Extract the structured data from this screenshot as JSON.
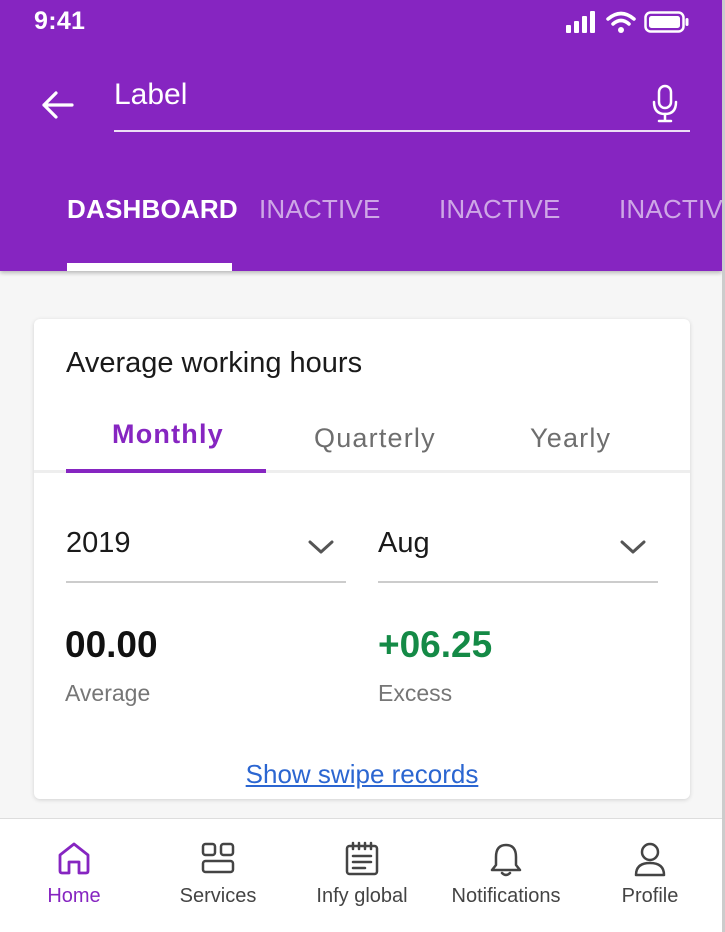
{
  "status_bar": {
    "time": "9:41"
  },
  "search": {
    "value": "Label"
  },
  "top_tabs": [
    {
      "label": "DASHBOARD",
      "active": true
    },
    {
      "label": "INACTIVE",
      "active": false
    },
    {
      "label": "INACTIVE",
      "active": false
    },
    {
      "label": "INACTIVE",
      "active": false
    }
  ],
  "card": {
    "title": "Average working hours",
    "period_tabs": [
      {
        "label": "Monthly",
        "active": true
      },
      {
        "label": "Quarterly",
        "active": false
      },
      {
        "label": "Yearly",
        "active": false
      }
    ],
    "year_select": {
      "value": "2019"
    },
    "month_select": {
      "value": "Aug"
    },
    "average": {
      "value": "00.00",
      "label": "Average"
    },
    "excess": {
      "value": "+06.25",
      "label": "Excess"
    },
    "link": "Show swipe records"
  },
  "bottom_nav": [
    {
      "label": "Home",
      "icon": "home-icon",
      "active": true
    },
    {
      "label": "Services",
      "icon": "grid-icon",
      "active": false
    },
    {
      "label": "Infy global",
      "icon": "notepad-icon",
      "active": false
    },
    {
      "label": "Notifications",
      "icon": "bell-icon",
      "active": false
    },
    {
      "label": "Profile",
      "icon": "person-icon",
      "active": false
    }
  ],
  "colors": {
    "primary": "#8625c1",
    "excess_green": "#148a46",
    "link_blue": "#2b66d1",
    "background": "#f6f6f6"
  }
}
